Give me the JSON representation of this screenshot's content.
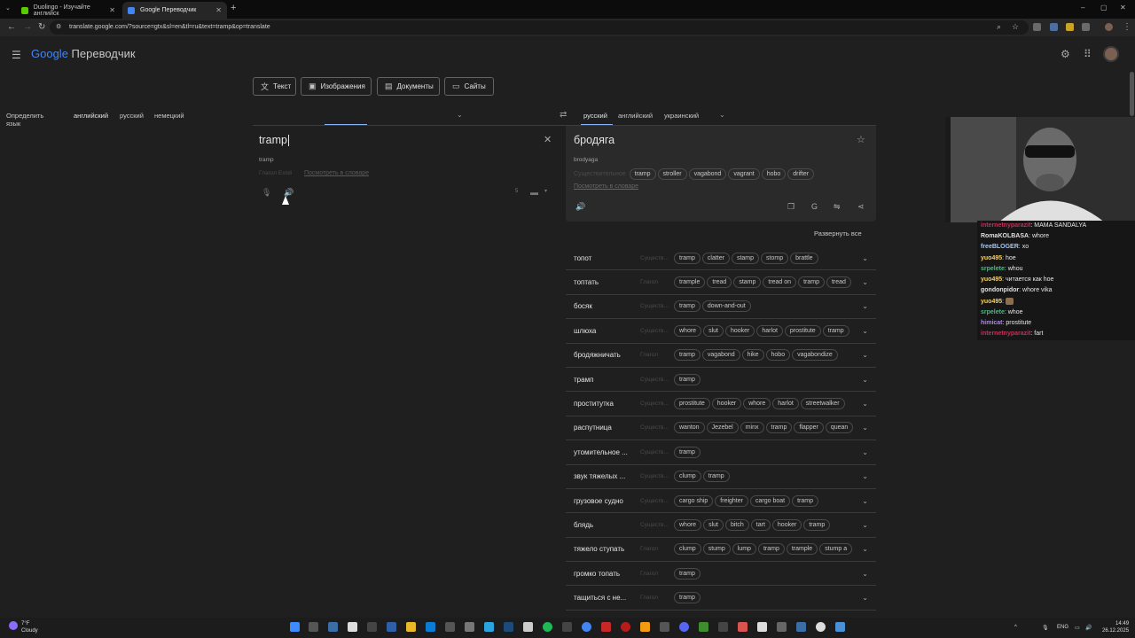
{
  "browser": {
    "tabs": [
      {
        "title": "Duolingo - Изучайте английск",
        "color": "#58cc02"
      },
      {
        "title": "Google Переводчик",
        "color": "#4285f4"
      }
    ],
    "url": "translate.google.com/?source=gtx&sl=en&tl=ru&text=tramp&op=translate"
  },
  "app": {
    "logo_google": "Google",
    "logo_product": "Переводчик"
  },
  "modes": [
    "Текст",
    "Изображения",
    "Документы",
    "Сайты"
  ],
  "source_langs": [
    "Определить язык",
    "английский",
    "русский",
    "немецкий"
  ],
  "target_langs": [
    "русский",
    "английский",
    "украинский"
  ],
  "source": {
    "text": "tramp",
    "phonetic": "tramp",
    "label_faded": "Глагол Existi",
    "dict_link": "Посмотреть в словаре"
  },
  "target": {
    "text": "бродяга",
    "translit": "brodyaga",
    "pos_label": "Существительное",
    "synonyms": [
      "tramp",
      "stroller",
      "vagabond",
      "vagrant",
      "hobo",
      "drifter"
    ],
    "dict_link": "Посмотреть в словаре"
  },
  "expand_all": "Развернуть все",
  "dictionary": [
    {
      "word": "топот",
      "pos": "Существ...",
      "chips": [
        "tramp",
        "clatter",
        "stamp",
        "stomp",
        "brattle"
      ]
    },
    {
      "word": "топтать",
      "pos": "Глагол",
      "chips": [
        "trample",
        "tread",
        "stamp",
        "tread on",
        "tramp",
        "tread"
      ]
    },
    {
      "word": "босяк",
      "pos": "Существ...",
      "chips": [
        "tramp",
        "down-and-out"
      ]
    },
    {
      "word": "шлюха",
      "pos": "Существ...",
      "chips": [
        "whore",
        "slut",
        "hooker",
        "harlot",
        "prostitute",
        "tramp"
      ]
    },
    {
      "word": "бродяжничать",
      "pos": "Глагол",
      "chips": [
        "tramp",
        "vagabond",
        "hike",
        "hobo",
        "vagabondize"
      ]
    },
    {
      "word": "трамп",
      "pos": "Существ...",
      "chips": [
        "tramp"
      ]
    },
    {
      "word": "проститутка",
      "pos": "Существ...",
      "chips": [
        "prostitute",
        "hooker",
        "whore",
        "harlot",
        "streetwalker"
      ]
    },
    {
      "word": "распутница",
      "pos": "Существ...",
      "chips": [
        "wanton",
        "Jezebel",
        "minx",
        "tramp",
        "flapper",
        "quean"
      ]
    },
    {
      "word": "утомительное ...",
      "pos": "Существ...",
      "chips": [
        "tramp"
      ]
    },
    {
      "word": "звук тяжелых ...",
      "pos": "Существ...",
      "chips": [
        "clump",
        "tramp"
      ]
    },
    {
      "word": "грузовое судно",
      "pos": "Существ...",
      "chips": [
        "cargo ship",
        "freighter",
        "cargo boat",
        "tramp"
      ]
    },
    {
      "word": "блядь",
      "pos": "Существ...",
      "chips": [
        "whore",
        "slut",
        "bitch",
        "tart",
        "hooker",
        "tramp"
      ]
    },
    {
      "word": "тяжело ступать",
      "pos": "Глагол",
      "chips": [
        "clump",
        "stump",
        "lump",
        "tramp",
        "trample",
        "stump a"
      ]
    },
    {
      "word": "громко топать",
      "pos": "Глагол",
      "chips": [
        "tramp"
      ]
    },
    {
      "word": "тащиться с не...",
      "pos": "Глагол",
      "chips": [
        "tramp"
      ]
    }
  ],
  "chat": [
    {
      "user": "internetnyparazit",
      "msg": "MAMA SANDALYA",
      "color": "#c0305a"
    },
    {
      "user": "RomaKOLBASA",
      "msg": "whore",
      "color": "#e0e0e0"
    },
    {
      "user": "freeBLOGER",
      "msg": "xo",
      "color": "#a0c8ff"
    },
    {
      "user": "yuo495",
      "msg": "hoe",
      "color": "#ffd24a"
    },
    {
      "user": "srpelete",
      "msg": "whou",
      "color": "#40c080"
    },
    {
      "user": "yuo495",
      "msg": "читается как hoe",
      "color": "#ffd24a"
    },
    {
      "user": "gondonpidor",
      "msg": "whore vika",
      "color": "#e0e0e0"
    },
    {
      "user": "yuo495",
      "msg": "",
      "color": "#ffd24a"
    },
    {
      "user": "srpelete",
      "msg": "whoe",
      "color": "#40c080"
    },
    {
      "user": "himicat",
      "msg": "prostitute",
      "color": "#b080ff"
    },
    {
      "user": "internetnyparazit",
      "msg": "fart",
      "color": "#c0305a"
    }
  ],
  "taskbar": {
    "weather_temp": "7°F",
    "weather_desc": "Cloudy",
    "lang": "ENG",
    "time": "14:49",
    "date": "26.12.2025"
  }
}
